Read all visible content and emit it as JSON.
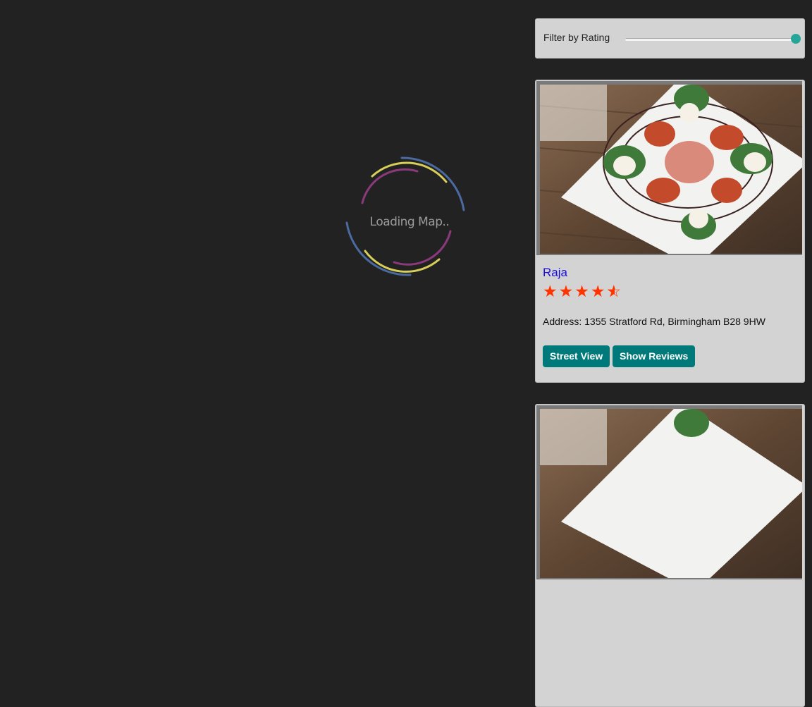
{
  "map": {
    "loading_text": "Loading Map.."
  },
  "filter": {
    "label": "Filter by Rating",
    "value_fraction": 1.0,
    "accent": "#26a69a"
  },
  "restaurants": [
    {
      "name": "Raja",
      "rating": 4.5,
      "address": "Address: 1355 Stratford Rd, Birmingham B28 9HW",
      "buttons": {
        "street_view": "Street View",
        "show_reviews": "Show Reviews"
      }
    }
  ],
  "colors": {
    "button_bg": "#00797b",
    "star": "#ff3300",
    "link": "#1a0dd8"
  }
}
